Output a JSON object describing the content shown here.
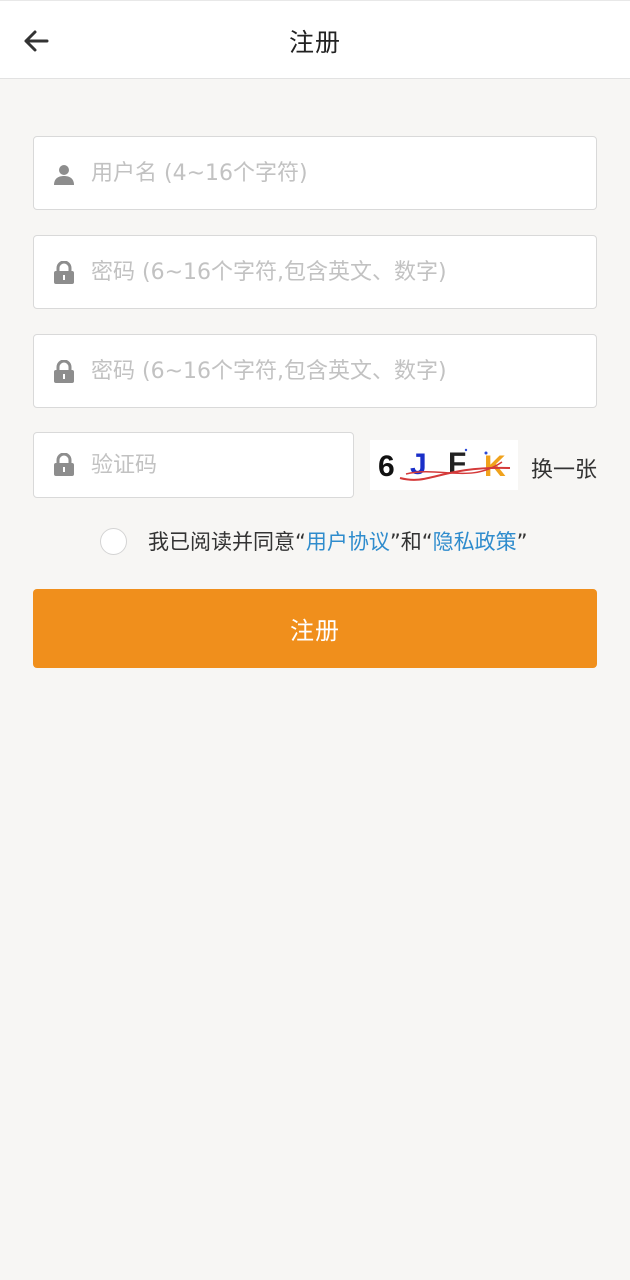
{
  "header": {
    "title": "注册",
    "back_icon": "arrow-left-icon"
  },
  "form": {
    "username": {
      "placeholder": "用户名 (4~16个字符)",
      "value": "",
      "icon": "user-icon"
    },
    "password": {
      "placeholder": "密码 (6~16个字符,包含英文、数字)",
      "value": "",
      "icon": "lock-icon"
    },
    "password_confirm": {
      "placeholder": "密码 (6~16个字符,包含英文、数字)",
      "value": "",
      "icon": "lock-icon"
    },
    "captcha": {
      "placeholder": "验证码",
      "value": "",
      "icon": "lock-icon"
    },
    "captcha_image": {
      "characters": [
        "6",
        "J",
        "F",
        "K"
      ],
      "colors": [
        "#111111",
        "#1a2fc8",
        "#222222",
        "#f0a21c"
      ]
    },
    "refresh_label": "换一张"
  },
  "agreement": {
    "checked": false,
    "prefix": "我已阅读并同意“",
    "user_agreement": "用户协议",
    "middle": "”和“",
    "privacy_policy": "隐私政策",
    "suffix": "”"
  },
  "submit_label": "注册",
  "colors": {
    "accent": "#f08f1c",
    "link": "#2f8ccd",
    "background": "#f7f6f4"
  }
}
